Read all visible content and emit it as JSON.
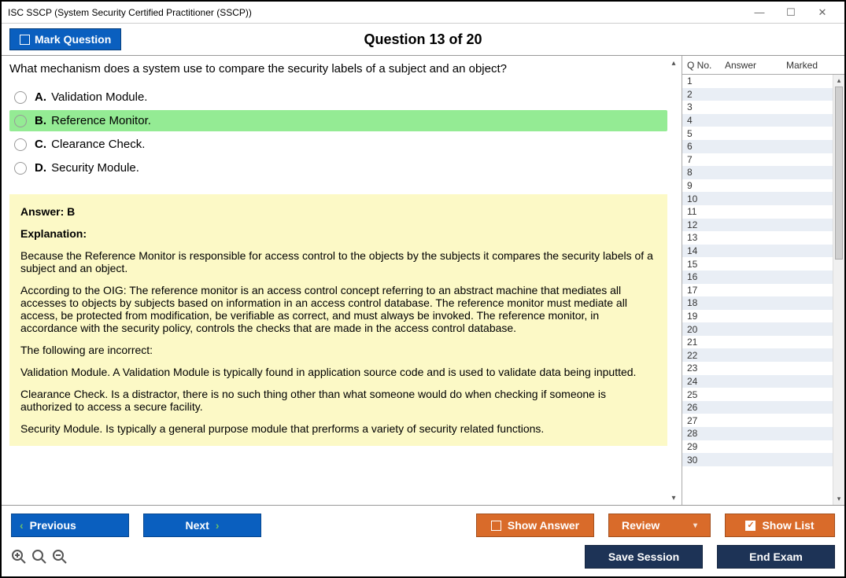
{
  "window": {
    "title": "ISC SSCP (System Security Certified Practitioner (SSCP))"
  },
  "header": {
    "mark_label": "Mark Question",
    "question_header": "Question 13 of 20"
  },
  "question": {
    "text": "What mechanism does a system use to compare the security labels of a subject and an object?",
    "options": [
      {
        "letter": "A.",
        "text": "Validation Module.",
        "correct": false
      },
      {
        "letter": "B.",
        "text": "Reference Monitor.",
        "correct": true
      },
      {
        "letter": "C.",
        "text": "Clearance Check.",
        "correct": false
      },
      {
        "letter": "D.",
        "text": "Security Module.",
        "correct": false
      }
    ]
  },
  "explanation": {
    "answer_line": "Answer: B",
    "heading": "Explanation:",
    "paragraphs": [
      "Because the Reference Monitor is responsible for access control to the objects by the subjects it compares the security labels of a subject and an object.",
      "According to the OIG: The reference monitor is an access control concept referring to an abstract machine that mediates all accesses to objects by subjects based on information in an access control database. The reference monitor must mediate all access, be protected from modification, be verifiable as correct, and must always be invoked. The reference monitor, in accordance with the security policy, controls the checks that are made in the access control database.",
      "The following are incorrect:",
      "Validation Module. A Validation Module is typically found in application source code and is used to validate data being inputted.",
      "Clearance Check. Is a distractor, there is no such thing other than what someone would do when checking if someone is authorized to access a secure facility.",
      "Security Module. Is typically a general purpose module that prerforms a variety of security related functions."
    ]
  },
  "sidebar": {
    "col_qno": "Q No.",
    "col_answer": "Answer",
    "col_marked": "Marked",
    "rows": [
      1,
      2,
      3,
      4,
      5,
      6,
      7,
      8,
      9,
      10,
      11,
      12,
      13,
      14,
      15,
      16,
      17,
      18,
      19,
      20,
      21,
      22,
      23,
      24,
      25,
      26,
      27,
      28,
      29,
      30
    ]
  },
  "footer": {
    "previous": "Previous",
    "next": "Next",
    "show_answer": "Show Answer",
    "review": "Review",
    "show_list": "Show List",
    "save_session": "Save Session",
    "end_exam": "End Exam"
  }
}
